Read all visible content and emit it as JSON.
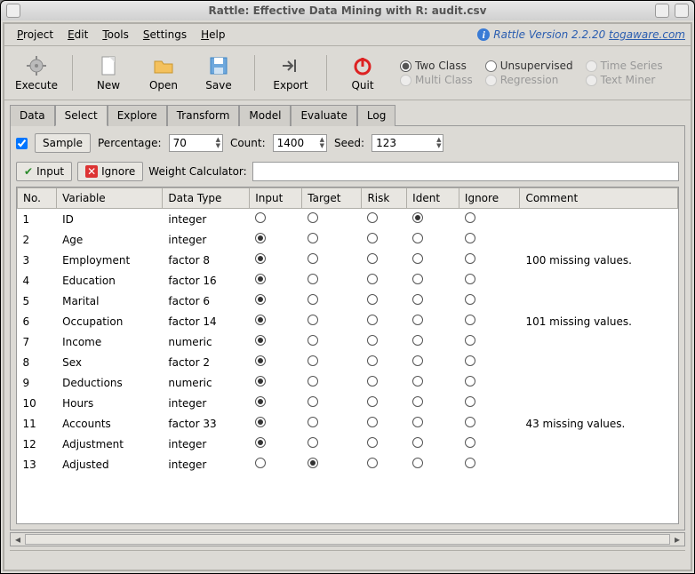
{
  "title": "Rattle: Effective Data Mining with R: audit.csv",
  "menu": [
    "Project",
    "Edit",
    "Tools",
    "Settings",
    "Help"
  ],
  "version_prefix": "Rattle Version 2.2.20 ",
  "version_link": "togaware.com",
  "toolbar": {
    "execute": "Execute",
    "new": "New",
    "open": "Open",
    "save": "Save",
    "export": "Export",
    "quit": "Quit"
  },
  "model_radios": {
    "twoclass": "Two Class",
    "multiclass": "Multi Class",
    "unsupervised": "Unsupervised",
    "regression": "Regression",
    "timeseries": "Time Series",
    "textminer": "Text Miner",
    "selected": "twoclass"
  },
  "tabs": [
    "Data",
    "Select",
    "Explore",
    "Transform",
    "Model",
    "Evaluate",
    "Log"
  ],
  "active_tab": "Select",
  "sample": {
    "button": "Sample",
    "checked": true,
    "percentage_label": "Percentage:",
    "percentage": "70",
    "count_label": "Count:",
    "count": "1400",
    "seed_label": "Seed:",
    "seed": "123"
  },
  "row2": {
    "input": "Input",
    "ignore": "Ignore",
    "wc_label": "Weight Calculator:",
    "wc_value": ""
  },
  "columns": [
    "No.",
    "Variable",
    "Data Type",
    "Input",
    "Target",
    "Risk",
    "Ident",
    "Ignore",
    "Comment"
  ],
  "rows": [
    {
      "no": "1",
      "var": "ID",
      "type": "integer",
      "sel": "Ident",
      "comment": ""
    },
    {
      "no": "2",
      "var": "Age",
      "type": "integer",
      "sel": "Input",
      "comment": ""
    },
    {
      "no": "3",
      "var": "Employment",
      "type": "factor 8",
      "sel": "Input",
      "comment": "100 missing values."
    },
    {
      "no": "4",
      "var": "Education",
      "type": "factor 16",
      "sel": "Input",
      "comment": ""
    },
    {
      "no": "5",
      "var": "Marital",
      "type": "factor 6",
      "sel": "Input",
      "comment": ""
    },
    {
      "no": "6",
      "var": "Occupation",
      "type": "factor 14",
      "sel": "Input",
      "comment": "101 missing values."
    },
    {
      "no": "7",
      "var": "Income",
      "type": "numeric",
      "sel": "Input",
      "comment": ""
    },
    {
      "no": "8",
      "var": "Sex",
      "type": "factor 2",
      "sel": "Input",
      "comment": ""
    },
    {
      "no": "9",
      "var": "Deductions",
      "type": "numeric",
      "sel": "Input",
      "comment": ""
    },
    {
      "no": "10",
      "var": "Hours",
      "type": "integer",
      "sel": "Input",
      "comment": ""
    },
    {
      "no": "11",
      "var": "Accounts",
      "type": "factor 33",
      "sel": "Input",
      "comment": "43 missing values."
    },
    {
      "no": "12",
      "var": "Adjustment",
      "type": "integer",
      "sel": "Input",
      "comment": ""
    },
    {
      "no": "13",
      "var": "Adjusted",
      "type": "integer",
      "sel": "Target",
      "comment": ""
    }
  ]
}
